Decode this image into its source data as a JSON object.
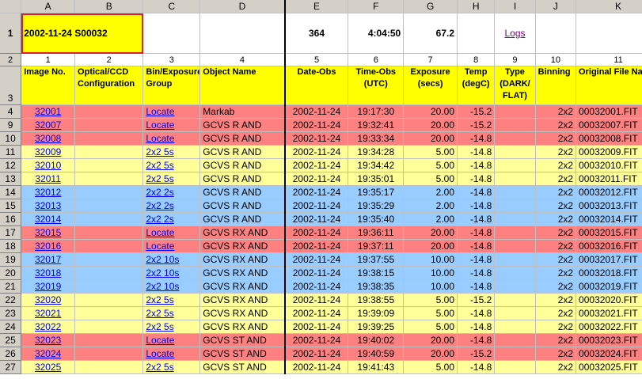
{
  "columns": [
    "A",
    "B",
    "C",
    "D",
    "E",
    "F",
    "G",
    "H",
    "I",
    "J",
    "K"
  ],
  "row1": {
    "title": "2002-11-24  S00032",
    "count": "364",
    "time": "4:04:50",
    "value": "67.2",
    "logs_link": "Logs"
  },
  "row2_numbers": [
    "1",
    "2",
    "3",
    "4",
    "5",
    "6",
    "7",
    "8",
    "9",
    "10",
    "11"
  ],
  "headers": [
    "Image No.",
    "Optical/CCD Configuration",
    "Bin/Exposure Group",
    "Object Name",
    "Date-Obs",
    "Time-Obs (UTC)",
    "Exposure (secs)",
    "Temp (degC)",
    "Type (DARK/ FLAT)",
    "Binning",
    "Original File Name"
  ],
  "rows": [
    {
      "num": "4",
      "img": "32001",
      "group": "Locate",
      "obj": "Markab",
      "date": "2002-11-24",
      "time": "19:17:30",
      "exp": "20.00",
      "temp": "-15.2",
      "bin": "2x2",
      "file": "00032001.FIT",
      "color": "red"
    },
    {
      "num": "9",
      "img": "32007",
      "group": "Locate",
      "obj": "GCVS R AND",
      "date": "2002-11-24",
      "time": "19:32:41",
      "exp": "20.00",
      "temp": "-15.2",
      "bin": "2x2",
      "file": "00032007.FIT",
      "color": "red"
    },
    {
      "num": "10",
      "img": "32008",
      "group": "Locate",
      "obj": "GCVS R AND",
      "date": "2002-11-24",
      "time": "19:33:34",
      "exp": "20.00",
      "temp": "-14.8",
      "bin": "2x2",
      "file": "00032008.FIT",
      "color": "red"
    },
    {
      "num": "11",
      "img": "32009",
      "group": "2x2 5s",
      "obj": "GCVS R AND",
      "date": "2002-11-24",
      "time": "19:34:28",
      "exp": "5.00",
      "temp": "-14.8",
      "bin": "2x2",
      "file": "00032009.FIT",
      "color": "lemon"
    },
    {
      "num": "12",
      "img": "32010",
      "group": "2x2 5s",
      "obj": "GCVS R AND",
      "date": "2002-11-24",
      "time": "19:34:42",
      "exp": "5.00",
      "temp": "-14.8",
      "bin": "2x2",
      "file": "00032010.FIT",
      "color": "lemon"
    },
    {
      "num": "13",
      "img": "32011",
      "group": "2x2 5s",
      "obj": "GCVS R AND",
      "date": "2002-11-24",
      "time": "19:35:01",
      "exp": "5.00",
      "temp": "-14.8",
      "bin": "2x2",
      "file": "00032011.FIT",
      "color": "lemon"
    },
    {
      "num": "14",
      "img": "32012",
      "group": "2x2 2s",
      "obj": "GCVS R AND",
      "date": "2002-11-24",
      "time": "19:35:17",
      "exp": "2.00",
      "temp": "-14.8",
      "bin": "2x2",
      "file": "00032012.FIT",
      "color": "blue"
    },
    {
      "num": "15",
      "img": "32013",
      "group": "2x2 2s",
      "obj": "GCVS R AND",
      "date": "2002-11-24",
      "time": "19:35:29",
      "exp": "2.00",
      "temp": "-14.8",
      "bin": "2x2",
      "file": "00032013.FIT",
      "color": "blue"
    },
    {
      "num": "16",
      "img": "32014",
      "group": "2x2 2s",
      "obj": "GCVS R AND",
      "date": "2002-11-24",
      "time": "19:35:40",
      "exp": "2.00",
      "temp": "-14.8",
      "bin": "2x2",
      "file": "00032014.FIT",
      "color": "blue"
    },
    {
      "num": "17",
      "img": "32015",
      "group": "Locate",
      "obj": "GCVS RX AND",
      "date": "2002-11-24",
      "time": "19:36:11",
      "exp": "20.00",
      "temp": "-14.8",
      "bin": "2x2",
      "file": "00032015.FIT",
      "color": "red"
    },
    {
      "num": "18",
      "img": "32016",
      "group": "Locate",
      "obj": "GCVS RX AND",
      "date": "2002-11-24",
      "time": "19:37:11",
      "exp": "20.00",
      "temp": "-14.8",
      "bin": "2x2",
      "file": "00032016.FIT",
      "color": "red"
    },
    {
      "num": "19",
      "img": "32017",
      "group": "2x2 10s",
      "obj": "GCVS RX AND",
      "date": "2002-11-24",
      "time": "19:37:55",
      "exp": "10.00",
      "temp": "-14.8",
      "bin": "2x2",
      "file": "00032017.FIT",
      "color": "blue"
    },
    {
      "num": "20",
      "img": "32018",
      "group": "2x2 10s",
      "obj": "GCVS RX AND",
      "date": "2002-11-24",
      "time": "19:38:15",
      "exp": "10.00",
      "temp": "-14.8",
      "bin": "2x2",
      "file": "00032018.FIT",
      "color": "blue"
    },
    {
      "num": "21",
      "img": "32019",
      "group": "2x2 10s",
      "obj": "GCVS RX AND",
      "date": "2002-11-24",
      "time": "19:38:35",
      "exp": "10.00",
      "temp": "-14.8",
      "bin": "2x2",
      "file": "00032019.FIT",
      "color": "blue"
    },
    {
      "num": "22",
      "img": "32020",
      "group": "2x2 5s",
      "obj": "GCVS RX AND",
      "date": "2002-11-24",
      "time": "19:38:55",
      "exp": "5.00",
      "temp": "-15.2",
      "bin": "2x2",
      "file": "00032020.FIT",
      "color": "lemon"
    },
    {
      "num": "23",
      "img": "32021",
      "group": "2x2 5s",
      "obj": "GCVS RX AND",
      "date": "2002-11-24",
      "time": "19:39:09",
      "exp": "5.00",
      "temp": "-14.8",
      "bin": "2x2",
      "file": "00032021.FIT",
      "color": "lemon"
    },
    {
      "num": "24",
      "img": "32022",
      "group": "2x2 5s",
      "obj": "GCVS RX AND",
      "date": "2002-11-24",
      "time": "19:39:25",
      "exp": "5.00",
      "temp": "-14.8",
      "bin": "2x2",
      "file": "00032022.FIT",
      "color": "lemon"
    },
    {
      "num": "25",
      "img": "32023",
      "group": "Locate",
      "obj": "GCVS ST AND",
      "date": "2002-11-24",
      "time": "19:40:02",
      "exp": "20.00",
      "temp": "-14.8",
      "bin": "2x2",
      "file": "00032023.FIT",
      "color": "red"
    },
    {
      "num": "26",
      "img": "32024",
      "group": "Locate",
      "obj": "GCVS ST AND",
      "date": "2002-11-24",
      "time": "19:40:59",
      "exp": "20.00",
      "temp": "-15.2",
      "bin": "2x2",
      "file": "00032024.FIT",
      "color": "red"
    },
    {
      "num": "27",
      "img": "32025",
      "group": "2x2 5s",
      "obj": "GCVS ST AND",
      "date": "2002-11-24",
      "time": "19:41:43",
      "exp": "5.00",
      "temp": "-14.8",
      "bin": "2x2",
      "file": "00032025.FIT",
      "color": "lemon"
    }
  ]
}
